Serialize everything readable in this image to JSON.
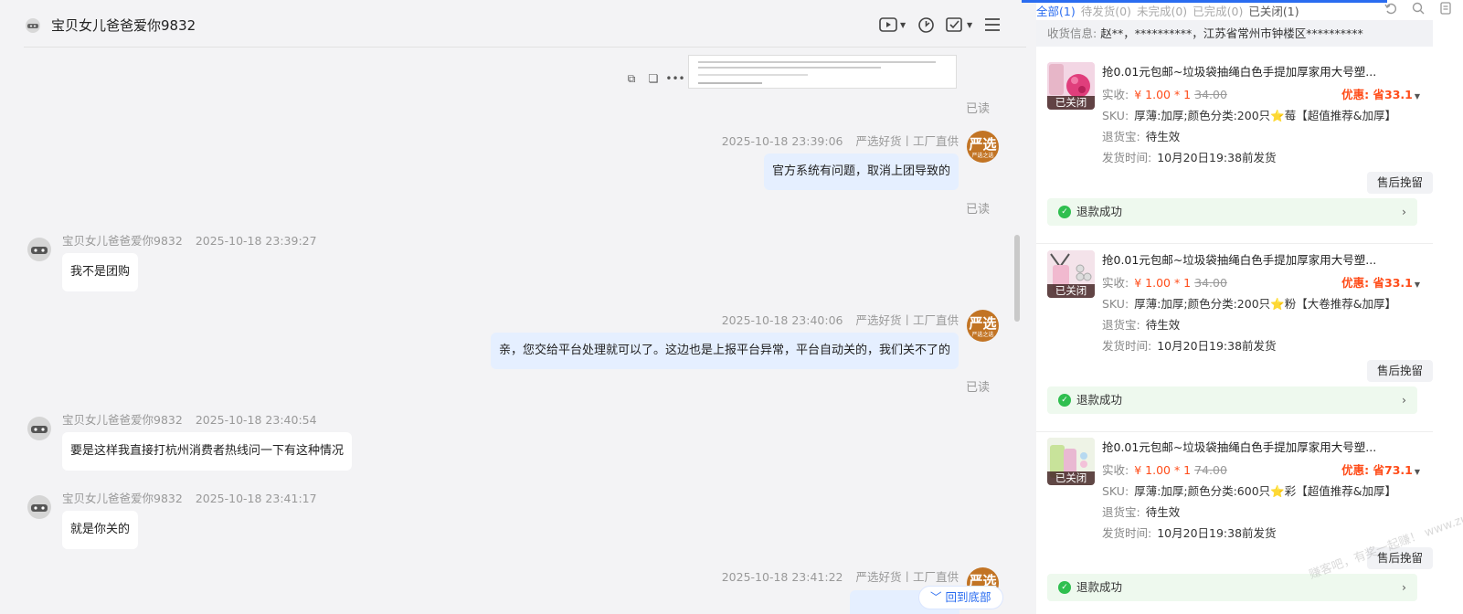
{
  "chat": {
    "contact_name": "宝贝女儿爸爸爱你9832",
    "read_label": "已读",
    "shop_name": "严选好货丨工厂直供",
    "shop_avatar": {
      "main": "严选",
      "sub": "严选之选"
    },
    "back_to_bottom": "回到底部",
    "messages": [
      {
        "time": "2025-10-18 23:39:06",
        "text": "官方系统有问题，取消上团导致的"
      },
      {
        "time": "2025-10-18 23:39:27",
        "text": "我不是团购"
      },
      {
        "time": "2025-10-18 23:40:06",
        "text": "亲，您交给平台处理就可以了。这边也是上报平台异常，平台自动关的，我们关不了的"
      },
      {
        "time": "2025-10-18 23:40:54",
        "text": "要是这样我直接打杭州消费者热线问一下有这种情况"
      },
      {
        "time": "2025-10-18 23:41:17",
        "text": "就是你关的"
      },
      {
        "time": "2025-10-18 23:41:22",
        "text": ""
      }
    ]
  },
  "orders_panel": {
    "tabs": [
      "全部(1)",
      "待发货(0)",
      "未完成(0)",
      "已完成(0)",
      "已关闭(1)"
    ],
    "shipping": {
      "label": "收货信息:",
      "value": "赵**，**********，江苏省常州市钟楼区**********"
    },
    "labels": {
      "paid": "实收:",
      "sku": "SKU:",
      "return_insurance": "退货宝:",
      "ship_time": "发货时间:",
      "closed_badge": "已关闭",
      "after_sale": "售后挽留",
      "refund_status": "退款成功"
    },
    "orders": [
      {
        "title": "抢0.01元包邮~垃圾袋抽绳白色手提加厚家用大号塑...",
        "paid": "¥ 1.00 * 1",
        "original": "34.00",
        "discount": "优惠: 省33.1",
        "sku": "厚薄:加厚;颜色分类:200只⭐莓【超值推荐&加厚】",
        "return_insurance": "待生效",
        "ship_time": "10月20日19:38前发货"
      },
      {
        "title": "抢0.01元包邮~垃圾袋抽绳白色手提加厚家用大号塑...",
        "paid": "¥ 1.00 * 1",
        "original": "34.00",
        "discount": "优惠: 省33.1",
        "sku": "厚薄:加厚;颜色分类:200只⭐粉【大卷推荐&加厚】",
        "return_insurance": "待生效",
        "ship_time": "10月20日19:38前发货"
      },
      {
        "title": "抢0.01元包邮~垃圾袋抽绳白色手提加厚家用大号塑...",
        "paid": "¥ 1.00 * 1",
        "original": "74.00",
        "discount": "优惠: 省73.1",
        "sku": "厚薄:加厚;颜色分类:600只⭐彩【超值推荐&加厚】",
        "return_insurance": "待生效",
        "ship_time": "10月20日19:38前发货"
      }
    ]
  },
  "watermark": "赚客吧，有奖一起赚！ www.zuanke8.com",
  "icons": [
    "video-call-icon",
    "refresh-circle-icon",
    "task-check-icon",
    "menu-icon",
    "copy-icon",
    "quote-icon",
    "more-icon",
    "undo-icon",
    "search-icon",
    "note-icon",
    "check-circle-icon",
    "chevron-right-icon",
    "chevron-down-icon"
  ],
  "colors": {
    "accent": "#2a6cf0",
    "price": "#ff4d1a",
    "success": "#2fbf4f",
    "outgoing_bubble": "#e5efff",
    "shop_avatar": "#c27424"
  }
}
